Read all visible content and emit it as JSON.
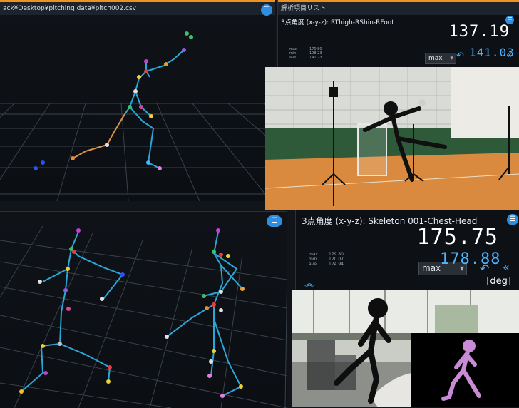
{
  "top_left": {
    "title": "ack¥Oesktop¥pitching data¥pitch002.csv"
  },
  "top_right": {
    "title": "解析項目リスト",
    "label": "3点角度 (x-y-z):  RThigh-RShin-RFoot",
    "big_value": "137.19",
    "small_value": "141.03",
    "stats": [
      {
        "k": "max",
        "v": "170.80"
      },
      {
        "k": "min",
        "v": "108.23"
      },
      {
        "k": "ave",
        "v": "141.23"
      }
    ],
    "dropdown": "max"
  },
  "bottom_right": {
    "label": "3点角度 (x-y-z):  Skeleton 001-Chest-Head",
    "big_value": "175.75",
    "small_value": "178.88",
    "stats": [
      {
        "k": "max",
        "v": "179.80"
      },
      {
        "k": "min",
        "v": "170.07"
      },
      {
        "k": "ave",
        "v": "174.94"
      }
    ],
    "dropdown": "max",
    "unit": "[deg]"
  },
  "icons": {
    "menu": "menu-icon",
    "undo": "undo-icon",
    "collapse": "double-chevron-left-icon",
    "expand": "double-chevron-up-icon"
  },
  "colors": {
    "accent": "#f0901f",
    "blue": "#2f8ee0",
    "bone": "#2aa7d8"
  }
}
